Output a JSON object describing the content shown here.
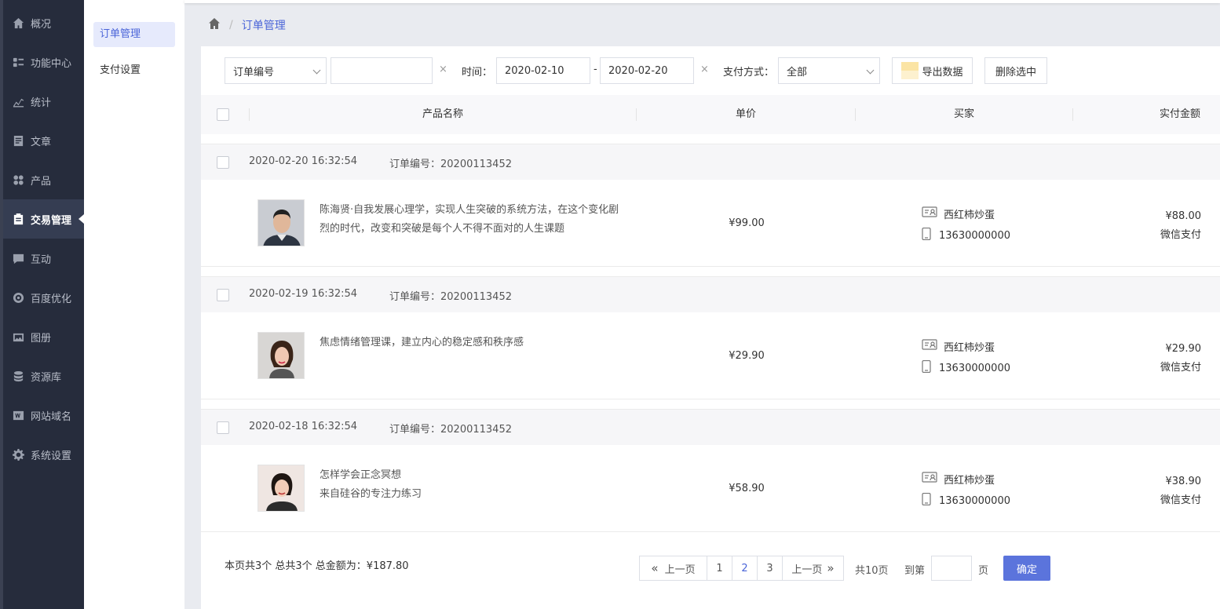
{
  "sidebar": {
    "items": [
      {
        "label": "概况",
        "icon": "home-icon"
      },
      {
        "label": "功能中心",
        "icon": "function-icon"
      },
      {
        "label": "统计",
        "icon": "chart-icon"
      },
      {
        "label": "文章",
        "icon": "article-icon"
      },
      {
        "label": "产品",
        "icon": "product-icon"
      },
      {
        "label": "交易管理",
        "icon": "trade-icon",
        "active": true
      },
      {
        "label": "互动",
        "icon": "chat-icon"
      },
      {
        "label": "百度优化",
        "icon": "seo-icon"
      },
      {
        "label": "图册",
        "icon": "album-icon"
      },
      {
        "label": "资源库",
        "icon": "database-icon"
      },
      {
        "label": "网站域名",
        "icon": "domain-icon"
      },
      {
        "label": "系统设置",
        "icon": "gear-icon"
      }
    ]
  },
  "subnav": {
    "items": [
      {
        "label": "订单管理",
        "active": true
      },
      {
        "label": "支付设置"
      }
    ]
  },
  "breadcrumb": {
    "current": "订单管理",
    "separator": "/"
  },
  "filters": {
    "field_select": "订单编号",
    "keyword_value": "",
    "clear_symbol": "×",
    "time_label": "时间：",
    "date_start": "2020-02-10",
    "date_dash": "-",
    "date_end": "2020-02-20",
    "pay_label": "支付方式：",
    "pay_select": "全部",
    "export_label": "导出数据",
    "delete_label": "删除选中"
  },
  "table": {
    "columns": [
      "产品名称",
      "单价",
      "买家",
      "实付金额"
    ]
  },
  "orders": [
    {
      "date": "2020-02-20 16:32:54",
      "order_no": "订单编号：20200113452",
      "product": "陈海贤·自我发展心理学，实现人生突破的系统方法，在这个变化剧烈的时代，改变和突破是每个人不得不面对的人生课题",
      "price": "¥99.00",
      "buyer_name": "西红柿炒蛋",
      "buyer_phone": "13630000000",
      "paid": "¥88.00",
      "pay_method": "微信支付"
    },
    {
      "date": "2020-02-19 16:32:54",
      "order_no": "订单编号：20200113452",
      "product": "焦虑情绪管理课，建立内心的稳定感和秩序感",
      "price": "¥29.90",
      "buyer_name": "西红柿炒蛋",
      "buyer_phone": "13630000000",
      "paid": "¥29.90",
      "pay_method": "微信支付"
    },
    {
      "date": "2020-02-18 16:32:54",
      "order_no": "订单编号：20200113452",
      "product": "怎样学会正念冥想\n来自硅谷的专注力练习",
      "price": "¥58.90",
      "buyer_name": "西红柿炒蛋",
      "buyer_phone": "13630000000",
      "paid": "¥38.90",
      "pay_method": "微信支付"
    }
  ],
  "footer": {
    "summary": "本页共3个 总共3个 总金额为：¥187.80",
    "prev": "上一页",
    "pages": [
      "1",
      "2",
      "3"
    ],
    "current_page": "2",
    "next": "上一页",
    "total_pages": "共10页",
    "goto_label": "到第",
    "page_unit": "页",
    "confirm": "确定"
  },
  "colors": {
    "accent": "#4a64d8",
    "sidebar_bg": "#262c3c",
    "confirm_bg": "#5b74dc"
  }
}
